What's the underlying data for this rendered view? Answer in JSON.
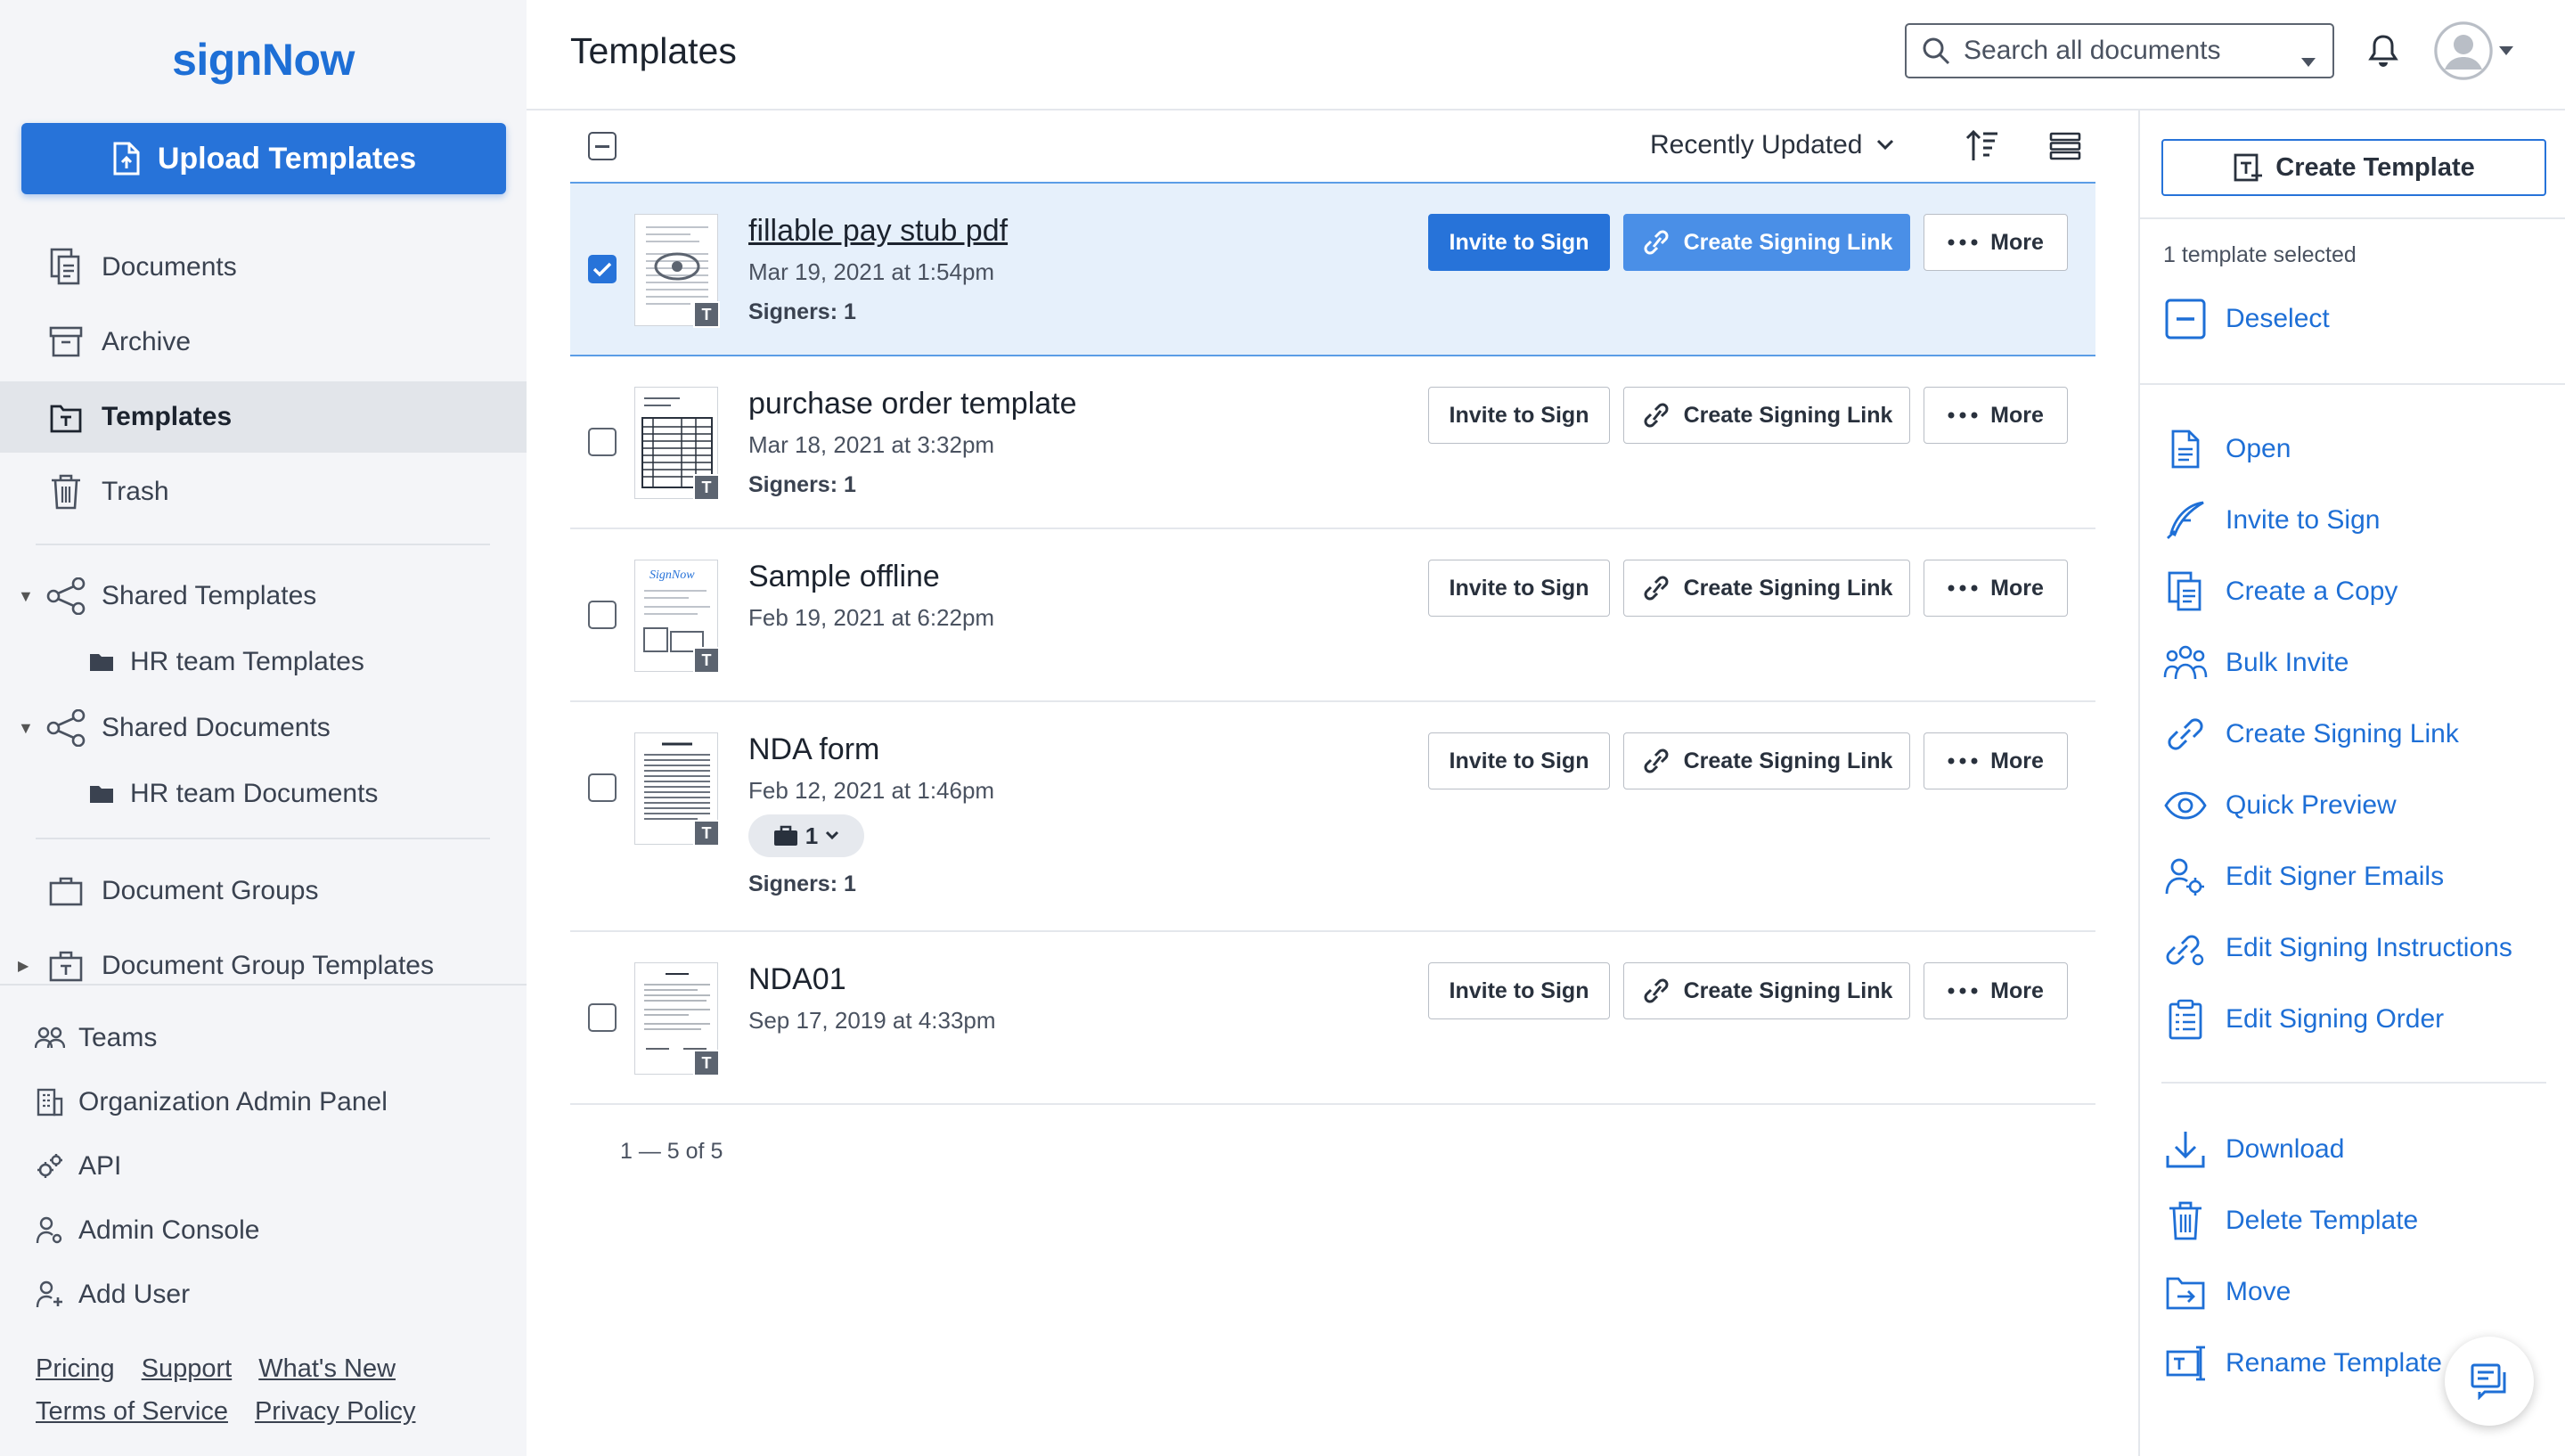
{
  "app": {
    "brand": "signNow",
    "accent": "#2773d9",
    "link_color": "#1e6fd6"
  },
  "sidebar": {
    "upload_label": "Upload Templates",
    "nav": [
      {
        "label": "Documents",
        "icon": "documents-icon"
      },
      {
        "label": "Archive",
        "icon": "archive-icon"
      },
      {
        "label": "Templates",
        "icon": "templates-icon",
        "active": true
      },
      {
        "label": "Trash",
        "icon": "trash-icon"
      }
    ],
    "shared_templates": {
      "label": "Shared Templates",
      "child": "HR team Templates"
    },
    "shared_documents": {
      "label": "Shared Documents",
      "child": "HR team Documents"
    },
    "document_groups": "Document Groups",
    "document_group_templates": "Document Group Templates",
    "bottom": [
      {
        "label": "Teams",
        "icon": "teams-icon"
      },
      {
        "label": "Organization Admin Panel",
        "icon": "organization-icon"
      },
      {
        "label": "API",
        "icon": "api-icon"
      },
      {
        "label": "Admin Console",
        "icon": "admin-console-icon"
      },
      {
        "label": "Add User",
        "icon": "add-user-icon"
      }
    ],
    "footer_row1": [
      "Pricing",
      "Support",
      "What's New"
    ],
    "footer_row2": [
      "Terms of Service",
      "Privacy Policy"
    ]
  },
  "header": {
    "title": "Templates",
    "search_placeholder": "Search all documents"
  },
  "toolbar": {
    "sort_label": "Recently Updated"
  },
  "buttons": {
    "invite": "Invite to Sign",
    "link": "Create Signing Link",
    "more": "More"
  },
  "rows": [
    {
      "name": "fillable pay stub pdf",
      "date": "Mar 19, 2021 at 1:54pm",
      "signers": "Signers: 1",
      "selected": true
    },
    {
      "name": "purchase order template",
      "date": "Mar 18, 2021 at 3:32pm",
      "signers": "Signers: 1"
    },
    {
      "name": "Sample offline",
      "date": "Feb 19, 2021 at 6:22pm"
    },
    {
      "name": "NDA form",
      "date": "Feb 12, 2021 at 1:46pm",
      "group_count": "1",
      "signers": "Signers: 1"
    },
    {
      "name": "NDA01",
      "date": "Sep 17, 2019 at 4:33pm"
    }
  ],
  "pagination": "1 — 5 of 5",
  "right_panel": {
    "create_label": "Create Template",
    "selected_count": "1 template selected",
    "deselect": "Deselect",
    "actions": [
      {
        "label": "Open",
        "icon": "open-icon"
      },
      {
        "label": "Invite to Sign",
        "icon": "quill-icon"
      },
      {
        "label": "Create a Copy",
        "icon": "copy-icon"
      },
      {
        "label": "Bulk Invite",
        "icon": "bulk-invite-icon"
      },
      {
        "label": "Create Signing Link",
        "icon": "link-icon"
      },
      {
        "label": "Quick Preview",
        "icon": "eye-icon"
      },
      {
        "label": "Edit Signer Emails",
        "icon": "edit-signer-icon"
      },
      {
        "label": "Edit Signing Instructions",
        "icon": "edit-instructions-icon"
      },
      {
        "label": "Edit Signing Order",
        "icon": "signing-order-icon"
      }
    ],
    "actions2": [
      {
        "label": "Download",
        "icon": "download-icon"
      },
      {
        "label": "Delete Template",
        "icon": "delete-icon"
      },
      {
        "label": "Move",
        "icon": "move-icon"
      },
      {
        "label": "Rename Template",
        "icon": "rename-icon"
      }
    ]
  }
}
